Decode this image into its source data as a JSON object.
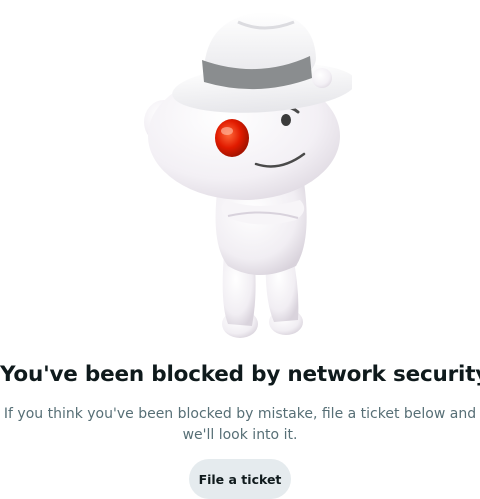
{
  "mascot": {
    "icon": "snoo-detective-mascot-icon",
    "colors": {
      "body": "#f3f1f5",
      "hat_band": "#8a8d8f",
      "eye": "#e11b00"
    }
  },
  "block_page": {
    "headline": "You've been blocked by network security.",
    "description_line1": "If you think you've been blocked by mistake, file a ticket below and",
    "description_line2": "we'll look into it.",
    "button_label": "File a ticket"
  }
}
